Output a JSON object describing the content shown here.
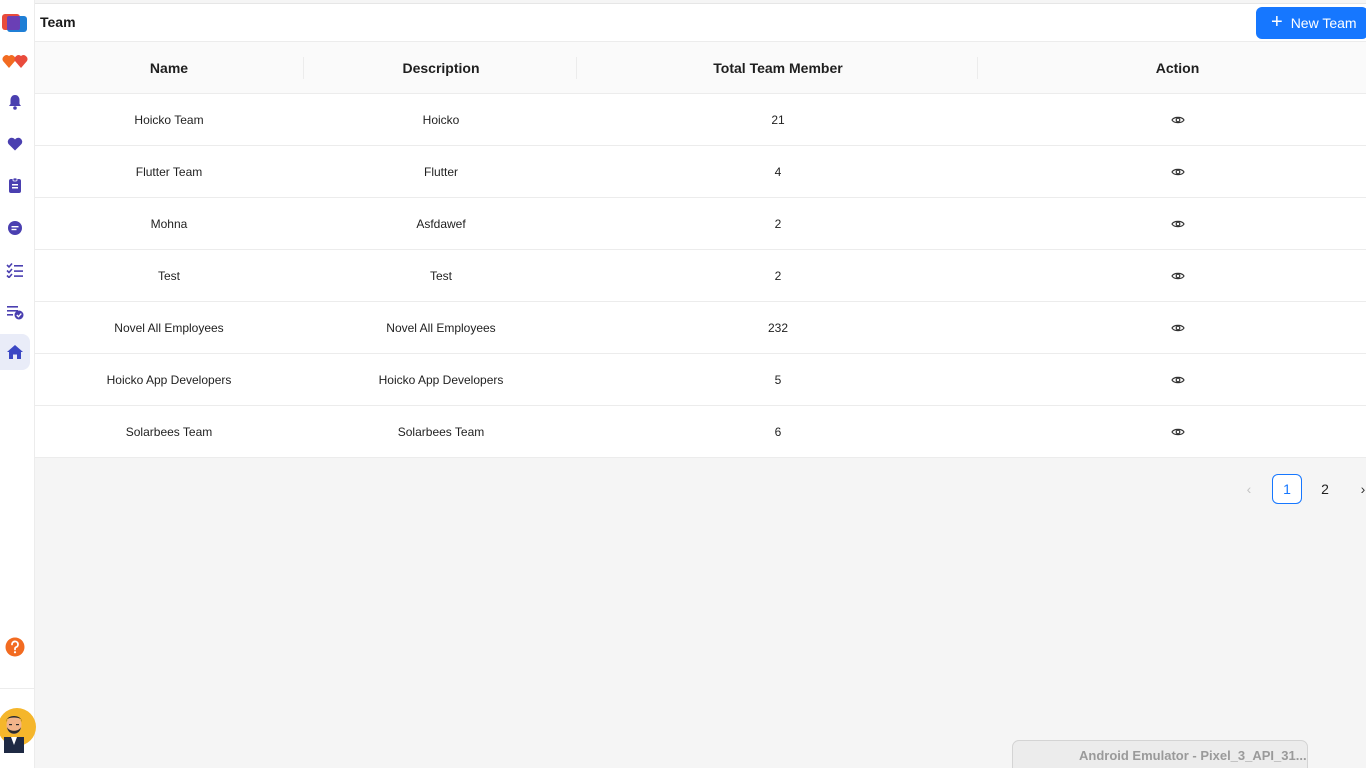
{
  "header": {
    "title": "Team",
    "new_button_label": "New Team"
  },
  "sidebar": {
    "items": [
      {
        "name": "logo-icon"
      },
      {
        "name": "hearts-icon"
      },
      {
        "name": "bell-icon"
      },
      {
        "name": "heart-icon"
      },
      {
        "name": "document-icon"
      },
      {
        "name": "chat-icon"
      },
      {
        "name": "checklist-icon"
      },
      {
        "name": "task-check-icon"
      },
      {
        "name": "home-icon",
        "active": true
      },
      {
        "name": "help-icon"
      },
      {
        "name": "avatar"
      }
    ]
  },
  "table": {
    "columns": [
      "Name",
      "Description",
      "Total Team Member",
      "Action"
    ],
    "rows": [
      {
        "name": "Hoicko Team",
        "description": "Hoicko",
        "members": "21"
      },
      {
        "name": "Flutter Team",
        "description": "Flutter",
        "members": "4"
      },
      {
        "name": "Mohna",
        "description": "Asfdawef",
        "members": "2"
      },
      {
        "name": "Test",
        "description": "Test",
        "members": "2"
      },
      {
        "name": "Novel All Employees",
        "description": "Novel All Employees",
        "members": "232"
      },
      {
        "name": "Hoicko App Developers",
        "description": "Hoicko App Developers",
        "members": "5"
      },
      {
        "name": "Solarbees Team",
        "description": "Solarbees Team",
        "members": "6"
      }
    ]
  },
  "pagination": {
    "pages": [
      "1",
      "2"
    ],
    "current": "1"
  },
  "emulator_tooltip": "Android Emulator - Pixel_3_API_31...",
  "colors": {
    "primary": "#1677ff",
    "sidebar_icon": "#4a3fb0",
    "help": "#f26b21"
  }
}
